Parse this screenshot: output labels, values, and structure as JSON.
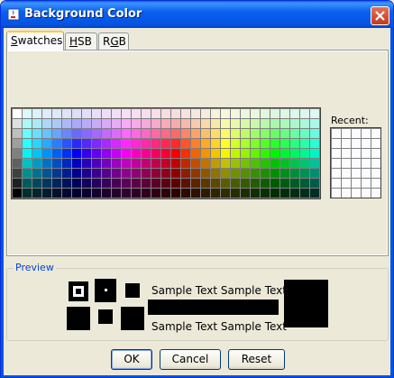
{
  "window": {
    "title": "Background Color",
    "colors": {
      "titlebar": "#0a5fe4",
      "frame": "#0055e5",
      "dialog_bg": "#ece9d8",
      "close_button": "#c4391a"
    }
  },
  "tabs": [
    {
      "label_pre": "",
      "mnemonic": "S",
      "label_post": "watches",
      "active": true
    },
    {
      "label_pre": "",
      "mnemonic": "H",
      "label_post": "SB",
      "active": false
    },
    {
      "label_pre": "R",
      "mnemonic": "G",
      "label_post": "B",
      "active": false
    }
  ],
  "swatches": {
    "columns": 31,
    "rows": 9,
    "recent_label": "Recent:",
    "recent_columns": 5,
    "recent_rows": 7
  },
  "preview": {
    "legend": "Preview",
    "sample_text_top": "Sample Text  Sample Text",
    "sample_text_bottom": "Sample Text  Sample Text",
    "selected_color": "#000000"
  },
  "buttons": {
    "ok": "OK",
    "cancel": "Cancel",
    "reset": "Reset"
  }
}
